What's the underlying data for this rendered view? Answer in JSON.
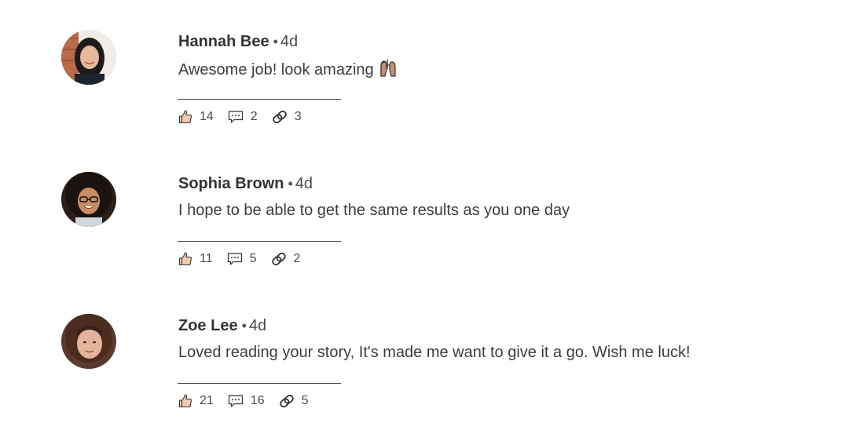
{
  "comments": [
    {
      "author": "Hannah Bee",
      "separator": "•",
      "time": "4d",
      "text": "Awesome job! look amazing",
      "emoji_icon": "raised-hands-icon",
      "likes": "14",
      "replies": "2",
      "shares": "3"
    },
    {
      "author": "Sophia Brown",
      "separator": "•",
      "time": "4d",
      "text": "I hope to be able to get the same results as you one day",
      "likes": "11",
      "replies": "5",
      "shares": "2"
    },
    {
      "author": "Zoe Lee",
      "separator": "•",
      "time": "4d",
      "text": "Loved reading your story, It's made me want to give it a go. Wish me luck!",
      "likes": "21",
      "replies": "16",
      "shares": "5"
    }
  ],
  "icons": {
    "like": "thumbs-up-icon",
    "reply": "speech-bubble-icon",
    "share": "link-chain-icon"
  }
}
